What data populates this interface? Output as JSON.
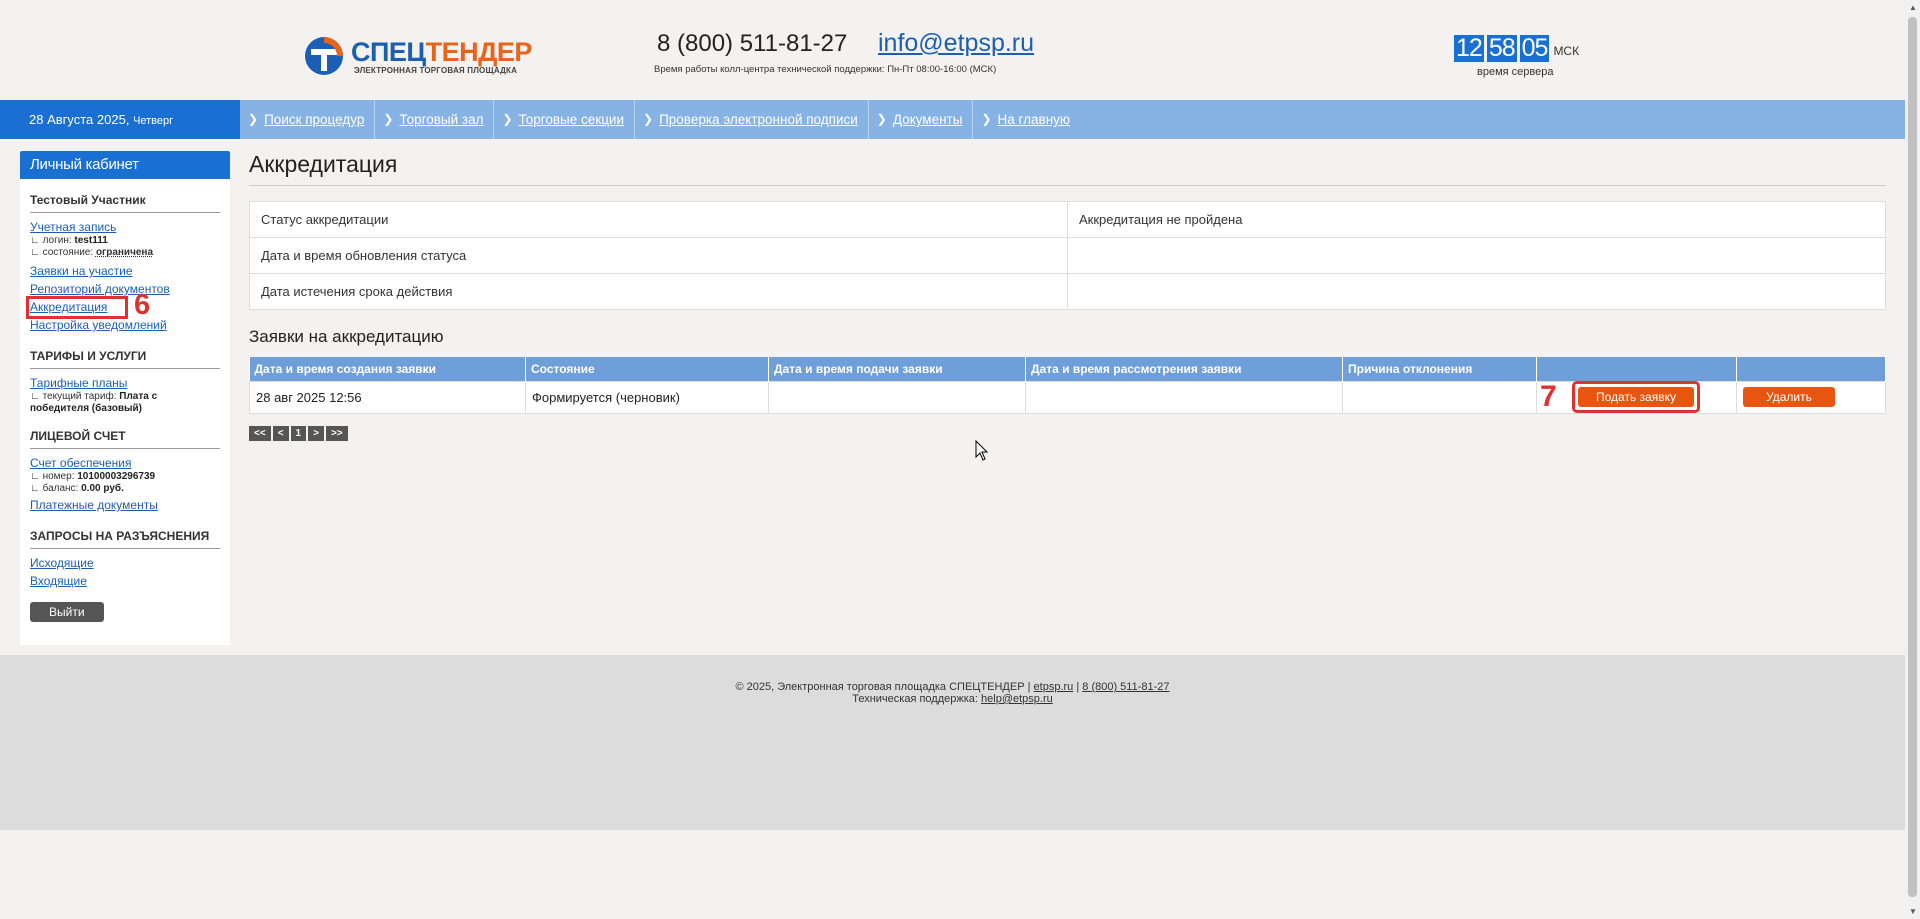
{
  "header": {
    "logo_part1": "СПЕЦ",
    "logo_part2": "ТЕНДЕР",
    "logo_sub": "ЭЛЕКТРОННАЯ ТОРГОВАЯ ПЛОЩАДКА",
    "phone": "8 (800) 511-81-27",
    "email": "info@etpsp.ru",
    "hours": "Время работы колл-центра технической поддержки: Пн-Пт 08:00-16:00 (МСК)",
    "clock": {
      "h": "12",
      "m": "58",
      "s": "05",
      "tz": "МСК",
      "label": "время сервера"
    }
  },
  "nav": {
    "date": "28 Августа 2025,",
    "weekday": "Четверг",
    "items": [
      {
        "label": "Поиск процедур"
      },
      {
        "label": "Торговый зал"
      },
      {
        "label": "Торговые секции"
      },
      {
        "label": "Проверка электронной подписи"
      },
      {
        "label": "Документы"
      },
      {
        "label": "На главную"
      }
    ]
  },
  "sidebar": {
    "header": "Личный кабинет",
    "user_name": "Тестовый Участник",
    "account_link": "Учетная запись",
    "login_label": "логин:",
    "login_value": "test111",
    "state_label": "состояние:",
    "state_value": "ограничена",
    "links": [
      "Заявки на участие",
      "Репозиторий документов",
      "Аккредитация",
      "Настройка уведомлений"
    ],
    "tariffs_title": "ТАРИФЫ И УСЛУГИ",
    "tariffs_link": "Тарифные планы",
    "tariff_label": "текущий тариф:",
    "tariff_value_1": "Плата с",
    "tariff_value_2": "победителя (базовый)",
    "account_title": "ЛИЦЕВОЙ СЧЕТ",
    "deposit_link": "Счет обеспечения",
    "number_label": "номер:",
    "number_value": "10100003296739",
    "balance_label": "баланс:",
    "balance_value": "0.00 руб.",
    "payment_link": "Платежные документы",
    "requests_title": "ЗАПРОСЫ НА РАЗЪЯСНЕНИЯ",
    "outgoing_link": "Исходящие",
    "incoming_link": "Входящие",
    "logout": "Выйти",
    "marker_6": "6"
  },
  "main": {
    "title": "Аккредитация",
    "status_rows": [
      {
        "label": "Статус аккредитации",
        "value": "Аккредитация не пройдена"
      },
      {
        "label": "Дата и время обновления статуса",
        "value": ""
      },
      {
        "label": "Дата истечения срока действия",
        "value": ""
      }
    ],
    "requests_title": "Заявки на аккредитацию",
    "columns": [
      "Дата и время создания заявки",
      "Состояние",
      "Дата и время подачи заявки",
      "Дата и время рассмотрения заявки",
      "Причина отклонения",
      "",
      ""
    ],
    "row": {
      "created": "28 авг 2025 12:56",
      "state": "Формируется (черновик)",
      "submitted": "",
      "reviewed": "",
      "reason": ""
    },
    "submit_button": "Подать заявку",
    "delete_button": "Удалить",
    "marker_7": "7",
    "pager": [
      "<<",
      "<",
      "1",
      ">",
      ">>"
    ]
  },
  "footer": {
    "line1_text": "© 2025, Электронная торговая площадка СПЕЦТЕНДЕР |",
    "site": "etpsp.ru",
    "sep": "|",
    "phone": "8 (800) 511-81-27",
    "support_label": "Техническая поддержка:",
    "support_email": "help@etpsp.ru"
  },
  "colors": {
    "brand_blue": "#1a6fd3",
    "brand_orange": "#e8550f",
    "highlight_red": "#e03131"
  }
}
